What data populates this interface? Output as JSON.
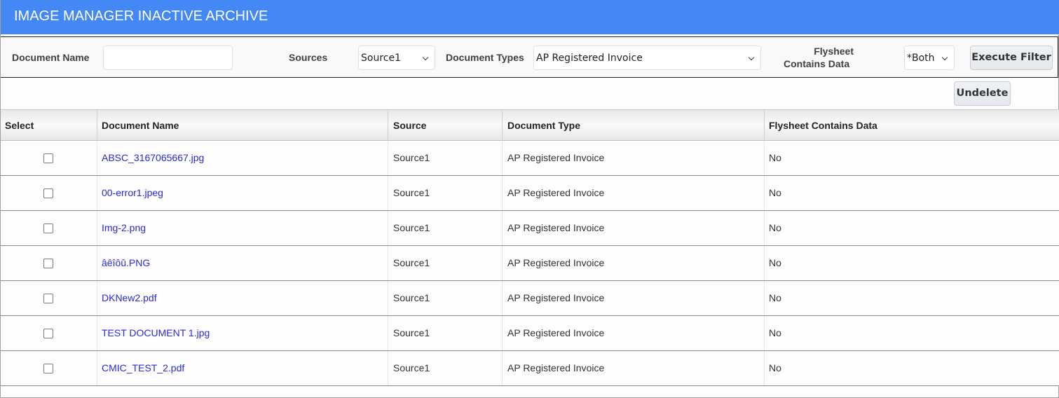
{
  "header": {
    "title": "IMAGE MANAGER INACTIVE ARCHIVE"
  },
  "filters": {
    "document_name_label": "Document Name",
    "document_name_value": "",
    "sources_label": "Sources",
    "sources_value": "Source1",
    "document_types_label": "Document Types",
    "document_types_value": "AP Registered Invoice",
    "flysheet_label_line1": "Flysheet",
    "flysheet_label_line2": "Contains Data",
    "flysheet_value": "*Both",
    "execute_filter_label": "Execute Filter"
  },
  "actions": {
    "undelete_label": "Undelete"
  },
  "table": {
    "columns": [
      "Select",
      "Document Name",
      "Source",
      "Document Type",
      "Flysheet Contains Data"
    ],
    "rows": [
      {
        "selected": false,
        "document_name": "ABSC_3167065667.jpg",
        "source": "Source1",
        "document_type": "AP Registered Invoice",
        "flysheet": "No"
      },
      {
        "selected": false,
        "document_name": "00-error1.jpeg",
        "source": "Source1",
        "document_type": "AP Registered Invoice",
        "flysheet": "No"
      },
      {
        "selected": false,
        "document_name": "Img-2.png",
        "source": "Source1",
        "document_type": "AP Registered Invoice",
        "flysheet": "No"
      },
      {
        "selected": false,
        "document_name": "âêîôû.PNG",
        "source": "Source1",
        "document_type": "AP Registered Invoice",
        "flysheet": "No"
      },
      {
        "selected": false,
        "document_name": "DKNew2.pdf",
        "source": "Source1",
        "document_type": "AP Registered Invoice",
        "flysheet": "No"
      },
      {
        "selected": false,
        "document_name": "TEST DOCUMENT 1.jpg",
        "source": "Source1",
        "document_type": "AP Registered Invoice",
        "flysheet": "No"
      },
      {
        "selected": false,
        "document_name": "CMIC_TEST_2.pdf",
        "source": "Source1",
        "document_type": "AP Registered Invoice",
        "flysheet": "No"
      }
    ]
  },
  "colors": {
    "header_bg": "#4388f4",
    "link": "#2b2bd0"
  }
}
